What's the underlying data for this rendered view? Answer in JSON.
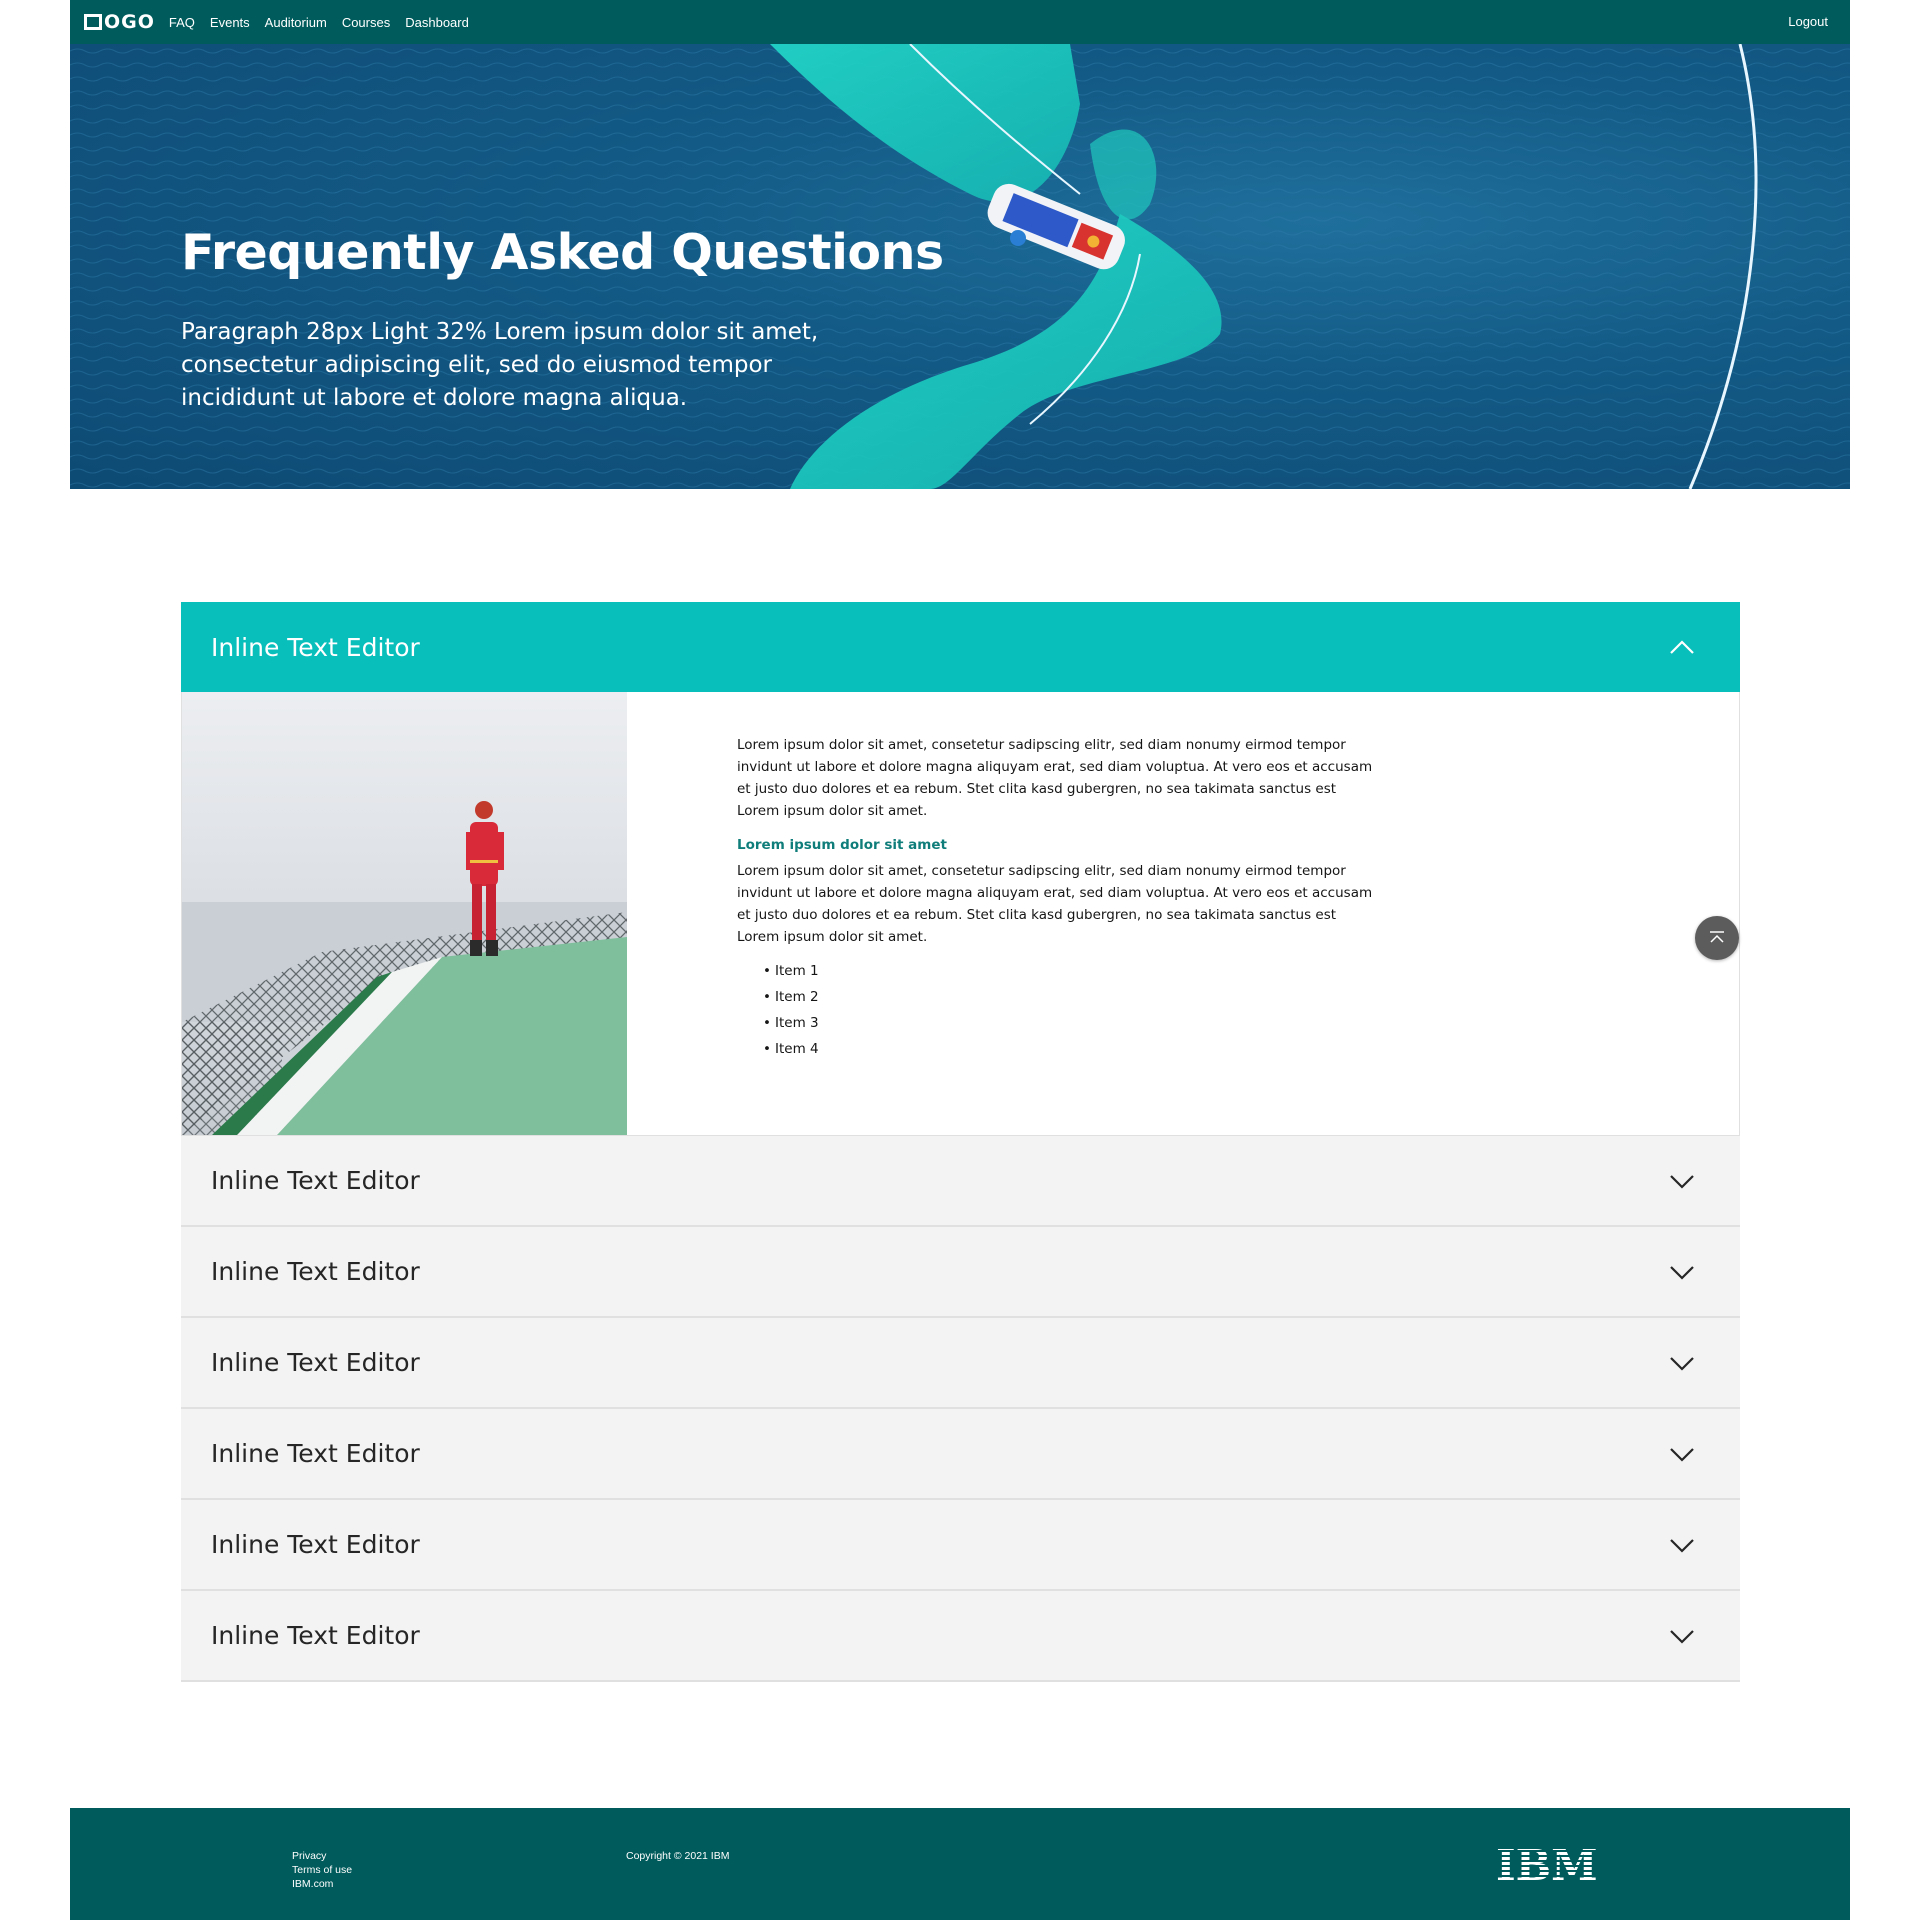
{
  "nav": {
    "logo_text": "OGO",
    "links": [
      "FAQ",
      "Events",
      "Auditorium",
      "Courses",
      "Dashboard"
    ],
    "logout": "Logout"
  },
  "hero": {
    "title": "Frequently Asked Questions",
    "subtitle": "Paragraph 28px Light 32% Lorem ipsum dolor sit amet, consectetur adipiscing elit, sed do eiusmod tempor incididunt ut labore et dolore magna aliqua."
  },
  "accordion": {
    "open_item": {
      "title": "Inline Text Editor",
      "paragraph1": "Lorem ipsum dolor sit amet, consetetur sadipscing elitr, sed diam nonumy eirmod tempor invidunt ut labore et dolore magna aliquyam erat, sed diam voluptua. At vero eos et accusam et justo duo dolores et ea rebum. Stet clita kasd gubergren, no sea takimata sanctus est Lorem ipsum dolor sit amet.",
      "subheading": "Lorem ipsum dolor sit amet",
      "paragraph2": "Lorem ipsum dolor sit amet, consetetur sadipscing elitr, sed diam nonumy eirmod tempor invidunt ut labore et dolore magna aliquyam erat, sed diam voluptua. At vero eos et accusam et justo duo dolores et ea rebum. Stet clita kasd gubergren, no sea takimata sanctus est Lorem ipsum dolor sit amet.",
      "list": [
        "Item 1",
        "Item 2",
        "Item 3",
        "Item 4"
      ]
    },
    "collapsed_items": [
      "Inline Text Editor",
      "Inline Text Editor",
      "Inline Text Editor",
      "Inline Text Editor",
      "Inline Text Editor",
      "Inline Text Editor"
    ],
    "accent_color": "#08bfbc"
  },
  "footer": {
    "links": [
      "Privacy",
      "Terms of use",
      "IBM.com"
    ],
    "copyright": "Copyright © 2021 IBM",
    "brand": "IBM",
    "color": "#005b5c"
  },
  "icons": {
    "expanded": "chevron-up-icon",
    "collapsed": "chevron-down-icon",
    "back_to_top": "arrow-up-to-top-icon"
  }
}
